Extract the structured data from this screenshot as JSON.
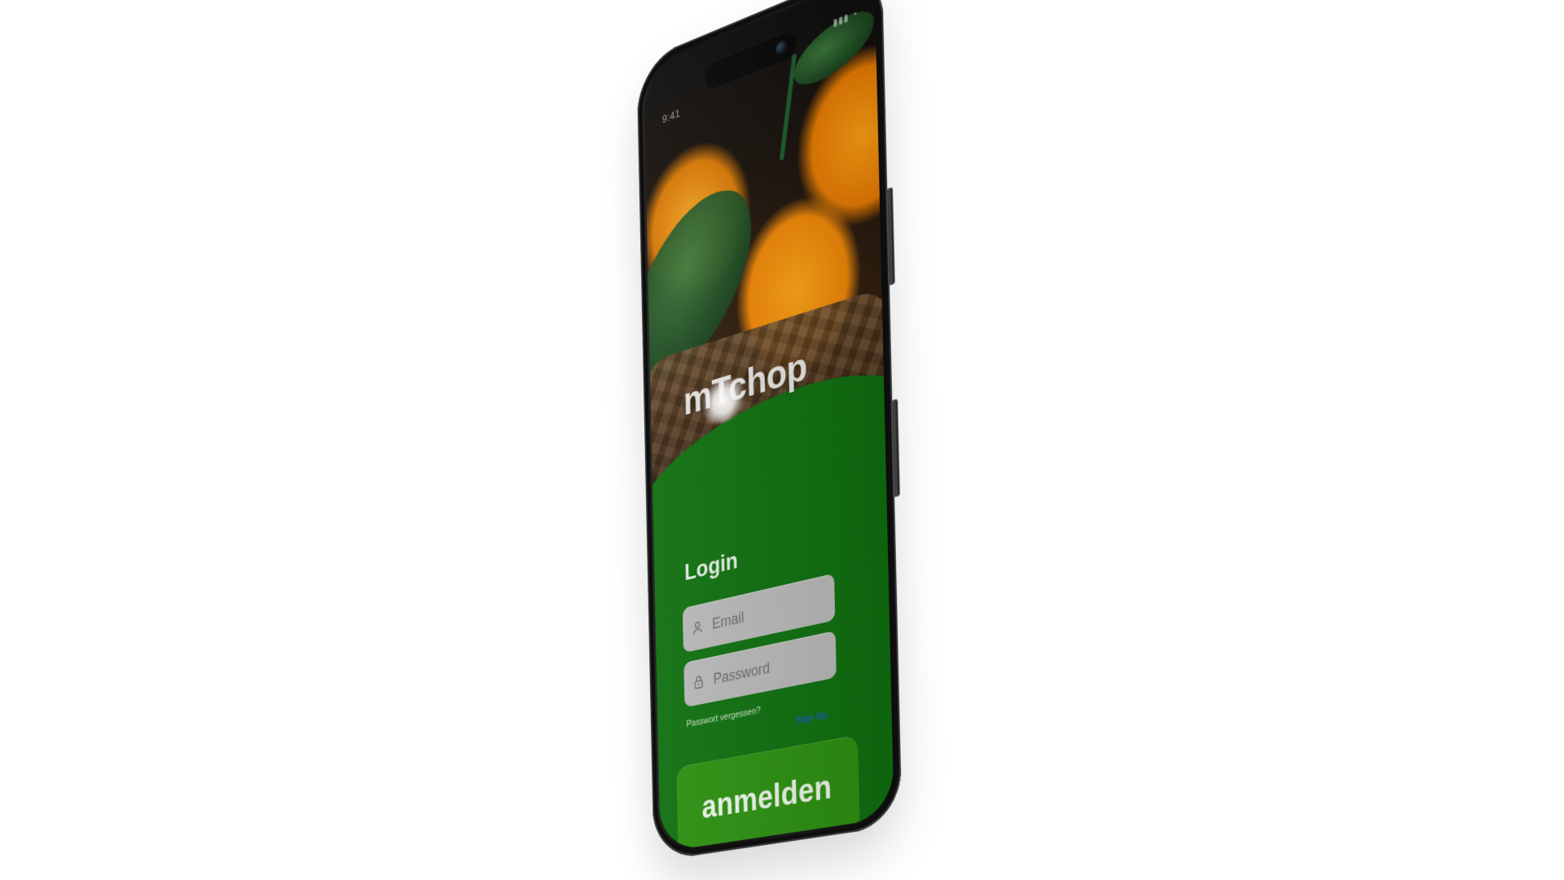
{
  "status_bar": {
    "time": "9:41",
    "icons": "▮▮▮ ◔"
  },
  "brand": {
    "name": "mTchop"
  },
  "login": {
    "title": "Login",
    "email_placeholder": "Email",
    "password_placeholder": "Password",
    "forgot_password": "Passwort vergessen?",
    "sign_up": "Sign Up",
    "submit_label": "anmelden"
  },
  "colors": {
    "form_green": "#0f6f0f",
    "button_green": "#2b8f10",
    "link_blue": "#1a5db8"
  }
}
